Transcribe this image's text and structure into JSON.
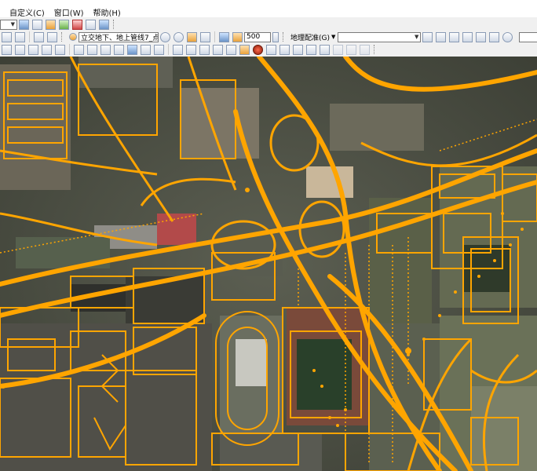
{
  "menu": {
    "items": [
      "自定义(C)",
      "窗口(W)",
      "帮助(H)"
    ]
  },
  "toolbar2": {
    "layer_combo_value": "立交地下、地上管线7_点",
    "scale_value": "500",
    "georef_label": "地理配准(G)",
    "georef_layer_value": ""
  },
  "map": {
    "kind": "satellite imagery with orange vector overlay",
    "overlay_color": "#ffa500",
    "background_color": "#4b4f43"
  }
}
